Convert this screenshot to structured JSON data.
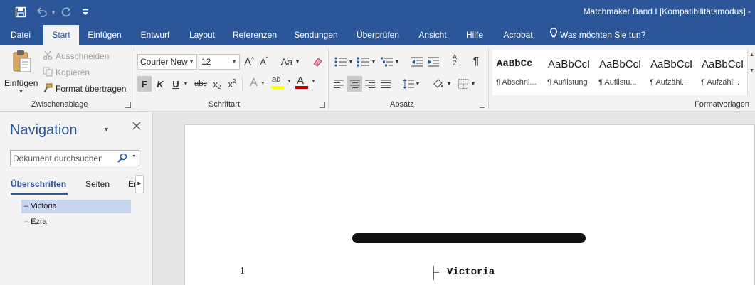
{
  "title_bar": {
    "document_title": "Matchmaker Band I [Kompatibilitätsmodus]  -"
  },
  "tabs": [
    {
      "label": "Datei"
    },
    {
      "label": "Start",
      "active": true
    },
    {
      "label": "Einfügen"
    },
    {
      "label": "Entwurf"
    },
    {
      "label": "Layout"
    },
    {
      "label": "Referenzen"
    },
    {
      "label": "Sendungen"
    },
    {
      "label": "Überprüfen"
    },
    {
      "label": "Ansicht"
    },
    {
      "label": "Hilfe"
    },
    {
      "label": "Acrobat"
    }
  ],
  "tell_me": "Was möchten Sie tun?",
  "clipboard": {
    "paste": "Einfügen",
    "cut": "Ausschneiden",
    "copy": "Kopieren",
    "format_painter": "Format übertragen",
    "group_label": "Zwischenablage"
  },
  "font": {
    "name": "Courier New",
    "size": "12",
    "grow": "A",
    "shrink": "A",
    "case": "Aa",
    "bold": "F",
    "italic": "K",
    "underline": "U",
    "strike": "abc",
    "subscript": "x",
    "subscript_mark": "2",
    "superscript": "x",
    "superscript_mark": "2",
    "effects": "A",
    "highlight": "ab",
    "color": "A",
    "group_label": "Schriftart"
  },
  "paragraph": {
    "sort": "A",
    "sort2": "Z",
    "pilcrow": "¶",
    "group_label": "Absatz"
  },
  "styles": {
    "items": [
      {
        "preview": "AaBbCc",
        "name": "¶ Abschni..."
      },
      {
        "preview": "AaBbCcI",
        "name": "¶ Auflistung"
      },
      {
        "preview": "AaBbCcI",
        "name": "¶ Auflistu..."
      },
      {
        "preview": "AaBbCcI",
        "name": "¶ Aufzähl..."
      },
      {
        "preview": "AaBbCcI",
        "name": "¶ Aufzähl..."
      }
    ],
    "group_label": "Formatvorlagen"
  },
  "navigation": {
    "title": "Navigation",
    "search_placeholder": "Dokument durchsuchen",
    "tabs": [
      {
        "label": "Überschriften",
        "active": true
      },
      {
        "label": "Seiten"
      },
      {
        "label": "Er"
      }
    ],
    "headings": [
      {
        "label": "– Victoria",
        "selected": true
      },
      {
        "label": "– Ezra",
        "selected": false
      }
    ]
  },
  "document": {
    "line_number": "1",
    "first_heading": "Victoria"
  },
  "colors": {
    "accent": "#2b579a",
    "selection": "#c5d6ee",
    "font_color_bar": "#c00000",
    "highlight_bar": "#ffff00"
  }
}
